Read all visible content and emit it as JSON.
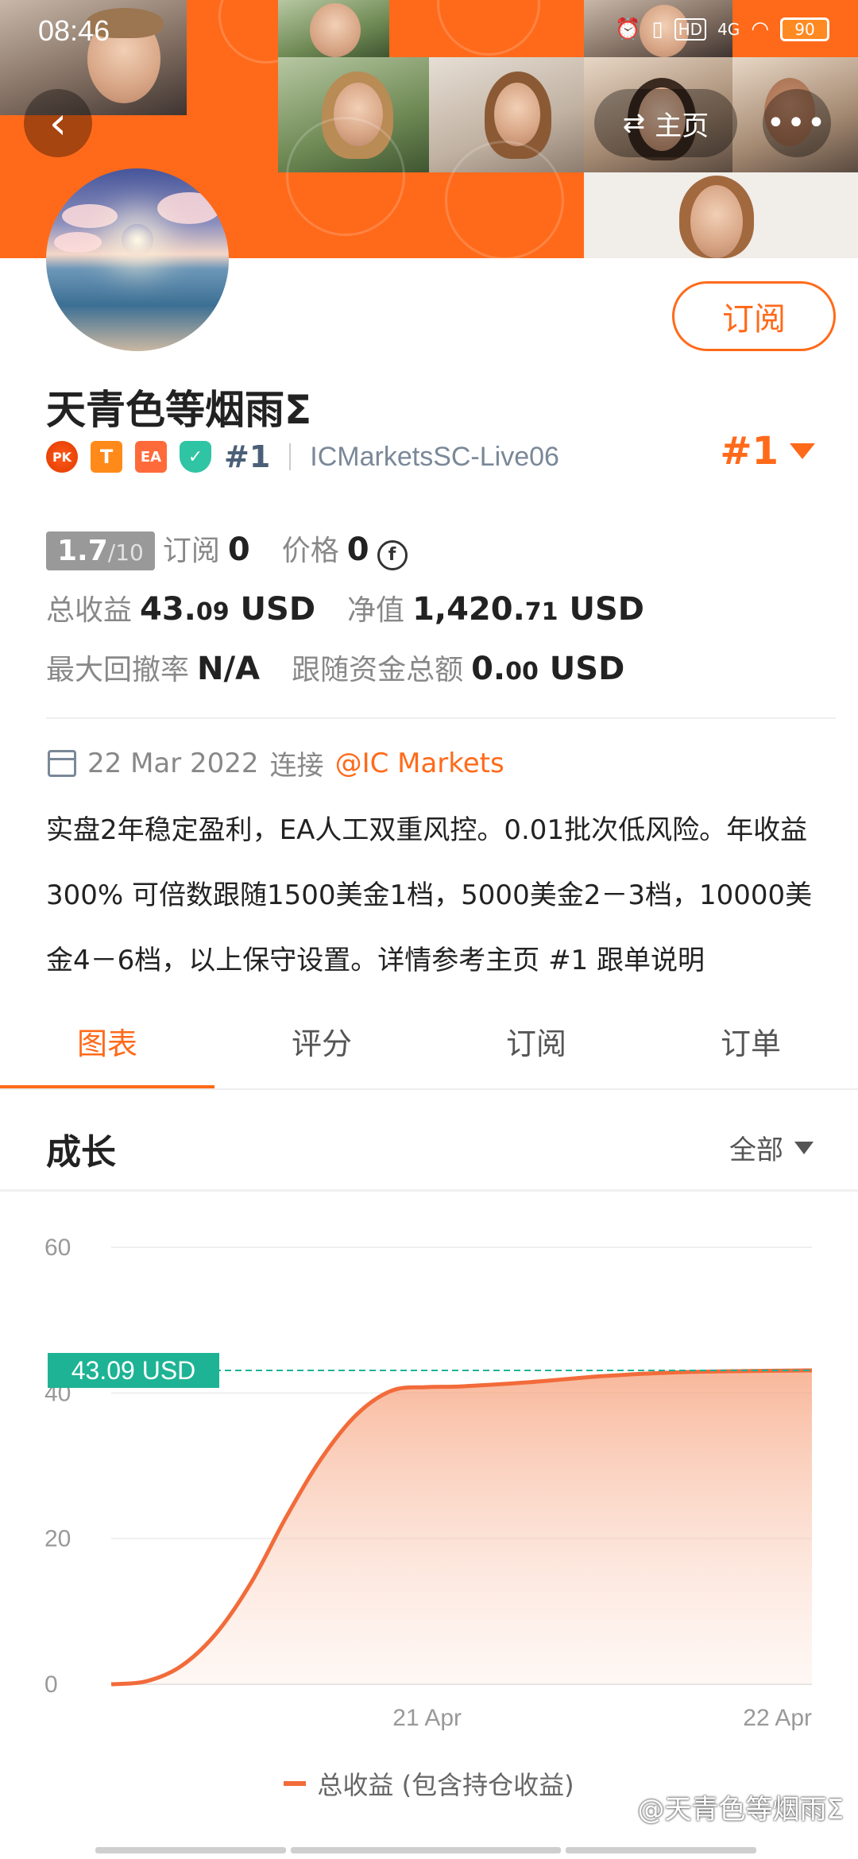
{
  "status_bar": {
    "time": "08:46",
    "battery": "90",
    "network": "4G",
    "hd": "HD"
  },
  "header": {
    "back_icon": "chevron-left-icon",
    "home_label": "主页",
    "home_icon": "swap-icon",
    "more_label": "•••"
  },
  "profile": {
    "name": "天青色等烟雨Σ",
    "subscribe_label": "订阅",
    "badges": [
      "PK",
      "T",
      "EA",
      "✓"
    ],
    "rank": "#1",
    "server": "ICMarketsSC-Live06",
    "rank_dropdown": "#1"
  },
  "stats": {
    "rating": "1.7",
    "rating_max": "/10",
    "subscribe_label": "订阅",
    "subscribe_count": "0",
    "price_label": "价格",
    "price_value": "0",
    "price_currency_icon": "f",
    "total_profit_label": "总收益",
    "total_profit_int": "43.",
    "total_profit_dec": "09",
    "total_profit_unit": " USD",
    "equity_label": "净值",
    "equity_int": "1,420.",
    "equity_dec": "71",
    "equity_unit": " USD",
    "drawdown_label": "最大回撤率",
    "drawdown_value": "N/A",
    "follow_label": "跟随资金总额",
    "follow_int": "0.",
    "follow_dec": "00",
    "follow_unit": " USD"
  },
  "meta": {
    "date": "22 Mar 2022",
    "connect_label": "连接",
    "broker": "@IC Markets"
  },
  "description": "实盘2年稳定盈利，EA人工双重风控。0.01批次低风险。年收益300% 可倍数跟随1500美金1档，5000美金2－3档，10000美金4－6档，以上保守设置。详情参考主页 #1 跟单说明",
  "tabs": [
    {
      "label": "图表",
      "active": true
    },
    {
      "label": "评分",
      "active": false
    },
    {
      "label": "订阅",
      "active": false
    },
    {
      "label": "订单",
      "active": false
    }
  ],
  "section": {
    "title": "成长",
    "filter_label": "全部"
  },
  "colors": {
    "accent": "#ff6a1a",
    "line": "#f26b3a",
    "label_bg": "#1db394"
  },
  "chart_data": {
    "type": "area",
    "yticks": [
      0,
      20,
      40,
      60
    ],
    "ylim": [
      0,
      60
    ],
    "xtick_labels": [
      "21 Apr",
      "22 Apr"
    ],
    "x": [
      0,
      0.05,
      0.1,
      0.15,
      0.2,
      0.25,
      0.3,
      0.35,
      0.4,
      0.45,
      0.5,
      0.6,
      0.7,
      0.8,
      0.9,
      1.0
    ],
    "series": [
      {
        "name": "总收益 (包含持仓收益)",
        "values": [
          0,
          0.4,
          2.5,
          7,
          14,
          23,
          31,
          37,
          40.3,
          40.8,
          40.9,
          41.5,
          42.3,
          42.8,
          43.0,
          43.09
        ]
      }
    ],
    "current_value_label": "43.09 USD",
    "current_value": 43.09,
    "legend": "总收益 (包含持仓收益)"
  },
  "watermark": "@天青色等烟雨Σ"
}
